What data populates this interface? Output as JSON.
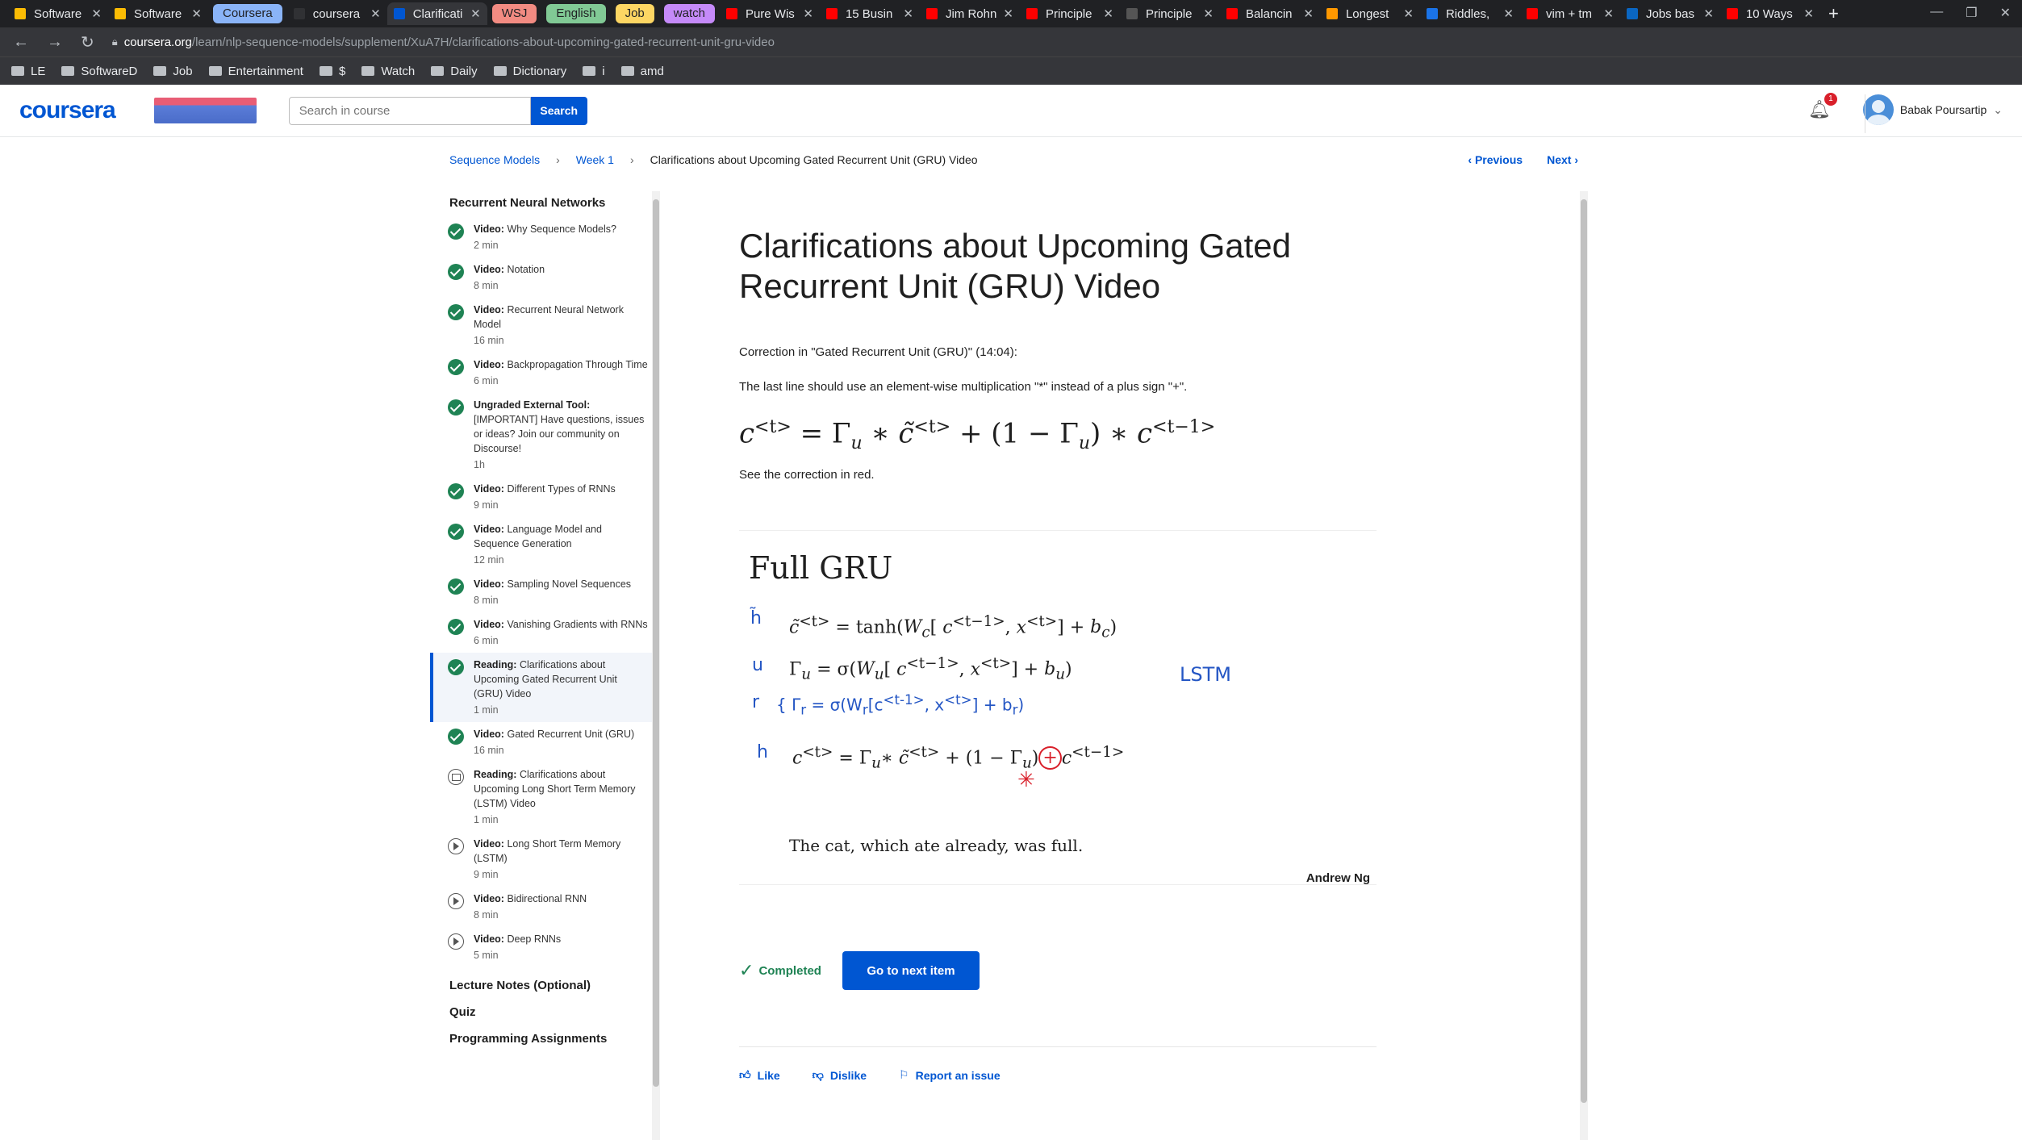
{
  "browser": {
    "tabs": [
      {
        "label": "Software",
        "color": "#fbbc04"
      },
      {
        "label": "Software",
        "color": "#fbbc04"
      },
      {
        "label": "coursera",
        "color": "#303134"
      },
      {
        "label": "Clarificati",
        "color": "#0056d2",
        "active": true
      },
      {
        "label": "Pure Wis",
        "color": "#ff0000"
      },
      {
        "label": "15 Busin",
        "color": "#ff0000"
      },
      {
        "label": "Jim Rohn",
        "color": "#ff0000"
      },
      {
        "label": "Principle",
        "color": "#ff0000"
      },
      {
        "label": "Principle",
        "color": "#555555"
      },
      {
        "label": "Balancin",
        "color": "#ff0000"
      },
      {
        "label": "Longest",
        "color": "#ff9800"
      },
      {
        "label": "Riddles,",
        "color": "#1a73e8"
      },
      {
        "label": "vim + tm",
        "color": "#ff0000"
      },
      {
        "label": "Jobs bas",
        "color": "#0a66c2"
      },
      {
        "label": "10 Ways",
        "color": "#ff0000"
      }
    ],
    "groups": [
      {
        "label": "Coursera",
        "color": "#8ab4f8"
      },
      {
        "label": "WSJ",
        "color": "#f28b82"
      },
      {
        "label": "English",
        "color": "#81c995"
      },
      {
        "label": "Job",
        "color": "#fdd663"
      },
      {
        "label": "watch",
        "color": "#c58af9"
      }
    ],
    "url_host": "coursera.org",
    "url_path": "/learn/nlp-sequence-models/supplement/XuA7H/clarifications-about-upcoming-gated-recurrent-unit-gru-video",
    "bookmarks": [
      "LE",
      "SoftwareD",
      "Job",
      "Entertainment",
      "$",
      "Watch",
      "Daily",
      "Dictionary",
      "i",
      "amd"
    ]
  },
  "header": {
    "logo": "coursera",
    "search_placeholder": "Search in course",
    "search_button": "Search",
    "notification_count": "1",
    "user_name": "Babak Poursartip"
  },
  "breadcrumb": {
    "course": "Sequence Models",
    "week": "Week 1",
    "current": "Clarifications about Upcoming Gated Recurrent Unit (GRU) Video"
  },
  "pager": {
    "previous": "Previous",
    "next": "Next"
  },
  "sidebar": {
    "heading": "Recurrent Neural Networks",
    "items": [
      {
        "kind": "Video:",
        "title": "Why Sequence Models?",
        "duration": "2 min",
        "status": "done"
      },
      {
        "kind": "Video:",
        "title": "Notation",
        "duration": "8 min",
        "status": "done"
      },
      {
        "kind": "Video:",
        "title": "Recurrent Neural Network Model",
        "duration": "16 min",
        "status": "done"
      },
      {
        "kind": "Video:",
        "title": "Backpropagation Through Time",
        "duration": "6 min",
        "status": "done"
      },
      {
        "kind": "Ungraded External Tool:",
        "title": "[IMPORTANT] Have questions, issues or ideas? Join our community on Discourse!",
        "duration": "1h",
        "status": "done"
      },
      {
        "kind": "Video:",
        "title": "Different Types of RNNs",
        "duration": "9 min",
        "status": "done"
      },
      {
        "kind": "Video:",
        "title": "Language Model and Sequence Generation",
        "duration": "12 min",
        "status": "done"
      },
      {
        "kind": "Video:",
        "title": "Sampling Novel Sequences",
        "duration": "8 min",
        "status": "done"
      },
      {
        "kind": "Video:",
        "title": "Vanishing Gradients with RNNs",
        "duration": "6 min",
        "status": "done"
      },
      {
        "kind": "Reading:",
        "title": "Clarifications about Upcoming Gated Recurrent Unit (GRU) Video",
        "duration": "1 min",
        "status": "done",
        "active": true
      },
      {
        "kind": "Video:",
        "title": "Gated Recurrent Unit (GRU)",
        "duration": "16 min",
        "status": "done"
      },
      {
        "kind": "Reading:",
        "title": "Clarifications about Upcoming Long Short Term Memory (LSTM) Video",
        "duration": "1 min",
        "status": "book"
      },
      {
        "kind": "Video:",
        "title": "Long Short Term Memory (LSTM)",
        "duration": "9 min",
        "status": "play"
      },
      {
        "kind": "Video:",
        "title": "Bidirectional RNN",
        "duration": "8 min",
        "status": "play"
      },
      {
        "kind": "Video:",
        "title": "Deep RNNs",
        "duration": "5 min",
        "status": "play"
      }
    ],
    "sections": [
      "Lecture Notes (Optional)",
      "Quiz",
      "Programming Assignments"
    ]
  },
  "content": {
    "title": "Clarifications about Upcoming Gated Recurrent Unit (GRU) Video",
    "para1": "Correction in \"Gated Recurrent Unit (GRU)\" (14:04):",
    "para2": "The last line should use an element-wise multiplication \"*\" instead of a plus sign \"+\".",
    "para3": "See the correction in red.",
    "figure": {
      "heading": "Full GRU",
      "caption": "The cat, which ate already, was full.",
      "author": "Andrew Ng",
      "annotation": "LSTM"
    },
    "completed": "Completed",
    "next_button": "Go to next item",
    "like": "Like",
    "dislike": "Dislike",
    "report": "Report an issue"
  }
}
